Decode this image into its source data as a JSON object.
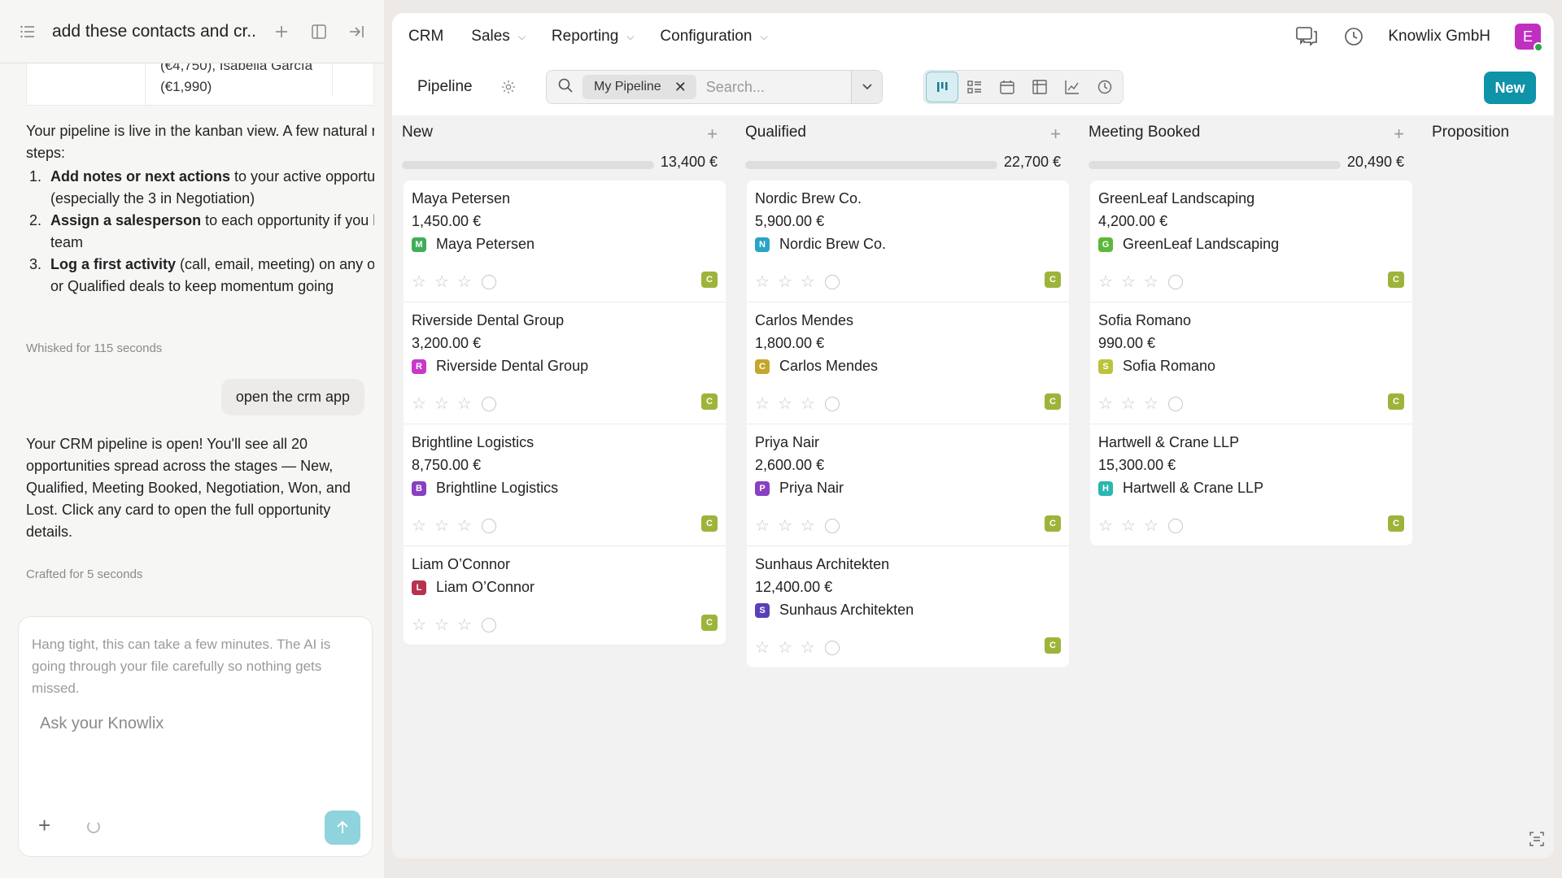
{
  "chat": {
    "title": "add these contacts and cr...",
    "prev_table_text": "(€4,750), Isabella García (€1,990)",
    "message1_intro": "Your pipeline is live in the kanban view. A few natural next steps:",
    "steps": [
      {
        "bold": "Add notes or next actions",
        "rest": " to your active opportunities",
        "line2": "(especially the 3 in Negotiation)"
      },
      {
        "bold": "Assign a salesperson",
        "rest": " to each opportunity if you have a",
        "line2": "team"
      },
      {
        "bold": "Log a first activity",
        "rest": " (call, email, meeting) on any of the New",
        "line2": "or Qualified deals to keep momentum going"
      }
    ],
    "meta1": "Whisked for 115 seconds",
    "user_message": "open the crm app",
    "message2": "Your CRM pipeline is open! You'll see all 20 opportunities spread across the stages — New, Qualified, Meeting Booked, Negotiation, Won, and Lost. Click any card to open the full opportunity details.",
    "meta2": "Crafted for 5 seconds",
    "composer_hint": "Hang tight, this can take a few minutes. The AI is going through your file carefully so nothing gets missed.",
    "composer_placeholder": "Ask your Knowlix"
  },
  "nav": {
    "app": "CRM",
    "menus": [
      "Sales",
      "Reporting",
      "Configuration"
    ],
    "company": "Knowlix GmbH",
    "avatar_letter": "E"
  },
  "control": {
    "breadcrumb": "Pipeline",
    "facet": "My Pipeline",
    "search_placeholder": "Search...",
    "new_button": "New"
  },
  "columns": [
    {
      "name": "New",
      "total": "13,400 €",
      "cards": [
        {
          "title": "Maya Petersen",
          "amount": "1,450.00 €",
          "contact": "Maya Petersen",
          "letter": "M",
          "color": "#3fae5a"
        },
        {
          "title": "Riverside Dental Group",
          "amount": "3,200.00 €",
          "contact": "Riverside Dental Group",
          "letter": "R",
          "color": "#c639c9"
        },
        {
          "title": "Brightline Logistics",
          "amount": "8,750.00 €",
          "contact": "Brightline Logistics",
          "letter": "B",
          "color": "#8a3fc2"
        },
        {
          "title": "Liam O’Connor",
          "amount": "",
          "contact": "Liam O’Connor",
          "letter": "L",
          "color": "#b8324f"
        }
      ]
    },
    {
      "name": "Qualified",
      "total": "22,700 €",
      "cards": [
        {
          "title": "Nordic Brew Co.",
          "amount": "5,900.00 €",
          "contact": "Nordic Brew Co.",
          "letter": "N",
          "color": "#2aa3c9"
        },
        {
          "title": "Carlos Mendes",
          "amount": "1,800.00 €",
          "contact": "Carlos Mendes",
          "letter": "C",
          "color": "#c5a52b"
        },
        {
          "title": "Priya Nair",
          "amount": "2,600.00 €",
          "contact": "Priya Nair",
          "letter": "P",
          "color": "#8a3fc2"
        },
        {
          "title": "Sunhaus Architekten",
          "amount": "12,400.00 €",
          "contact": "Sunhaus Architekten",
          "letter": "S",
          "color": "#5a3fb8"
        }
      ]
    },
    {
      "name": "Meeting Booked",
      "total": "20,490 €",
      "cards": [
        {
          "title": "GreenLeaf Landscaping",
          "amount": "4,200.00 €",
          "contact": "GreenLeaf Landscaping",
          "letter": "G",
          "color": "#5cb83a"
        },
        {
          "title": "Sofia Romano",
          "amount": "990.00 €",
          "contact": "Sofia Romano",
          "letter": "S",
          "color": "#b8c43a"
        },
        {
          "title": "Hartwell & Crane LLP",
          "amount": "15,300.00 €",
          "contact": "Hartwell & Crane LLP",
          "letter": "H",
          "color": "#2ab7b0"
        }
      ]
    },
    {
      "name": "Proposition",
      "total": "",
      "cards": []
    }
  ],
  "card_user_letter": "C"
}
